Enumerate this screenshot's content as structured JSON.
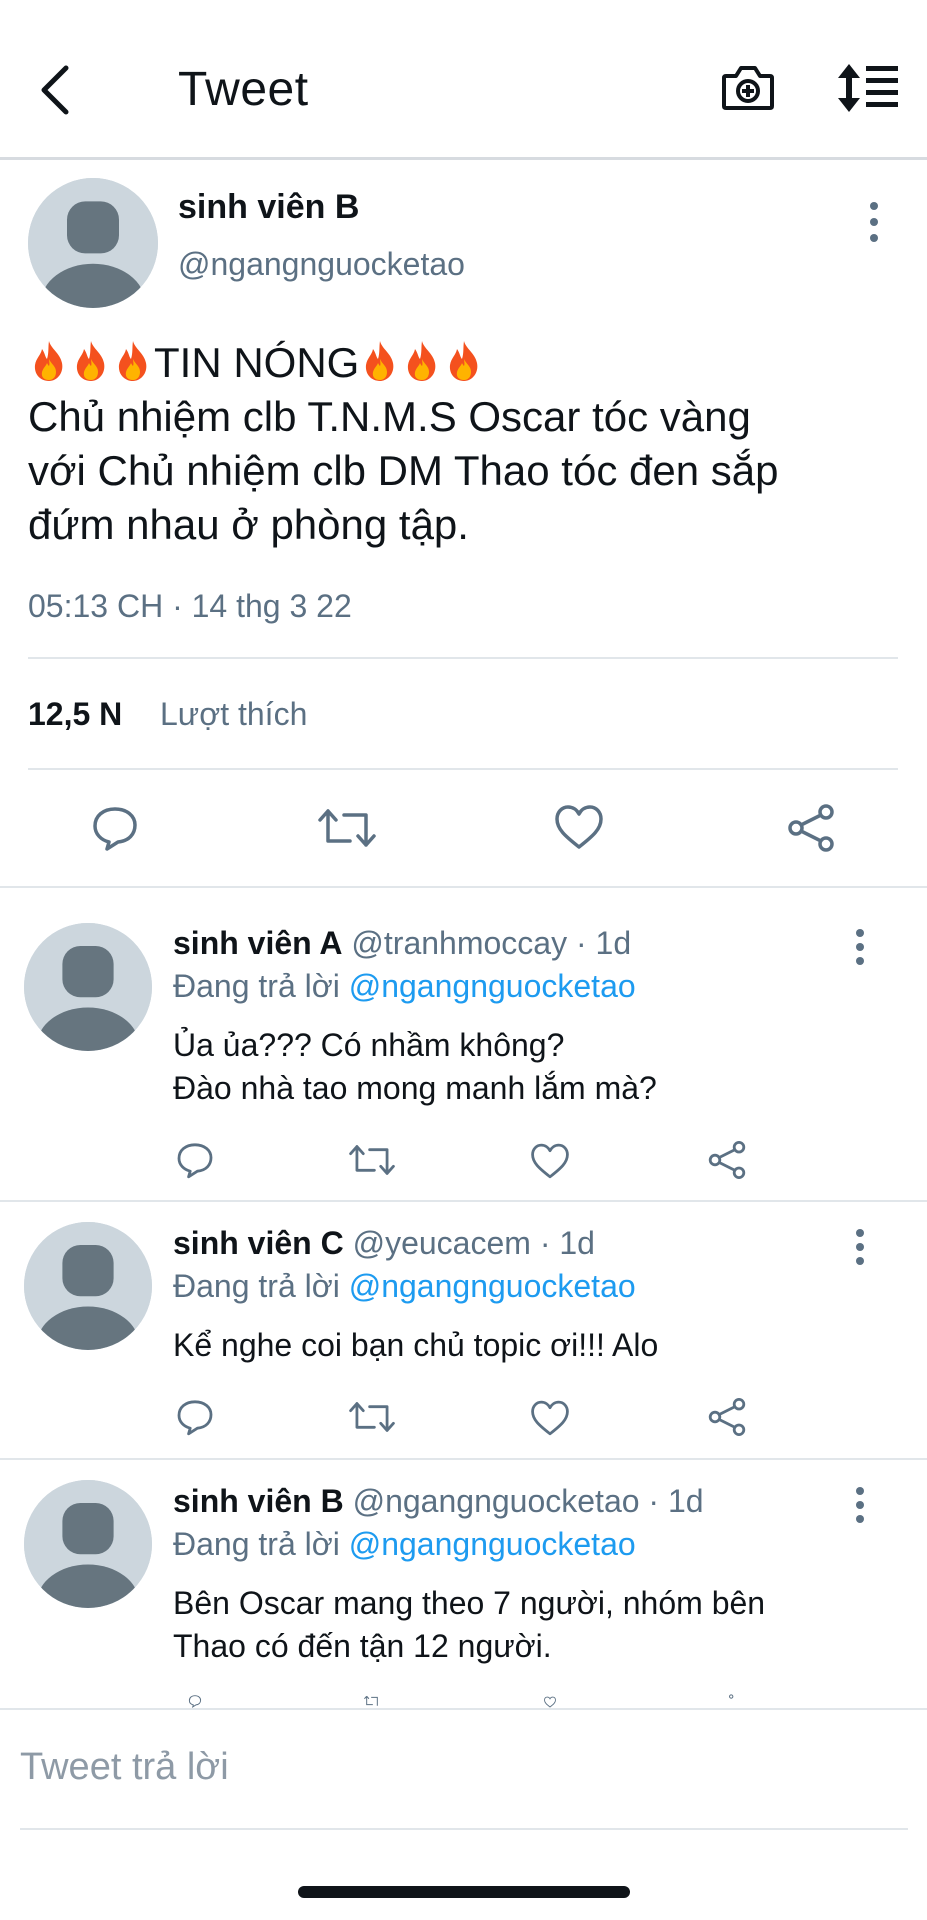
{
  "header": {
    "title": "Tweet",
    "back_icon": "chevron-left-icon",
    "camera_icon": "camera-add-icon",
    "sort_icon": "sort-list-icon"
  },
  "main_tweet": {
    "author_name": "sinh viên B",
    "author_handle": "@ngangnguocketao",
    "headline_text": "TIN NÓNG",
    "body_lines": [
      "Chủ nhiệm clb T.N.M.S Oscar tóc vàng",
      "với Chủ nhiệm clb DM Thao tóc đen sắp",
      "đứm nhau ở phòng tập."
    ],
    "timestamp": "05:13 CH · 14 thg 3 22",
    "likes_count": "12,5 N",
    "likes_label": "Lượt thích",
    "fire_emoji_count_each_side": 3
  },
  "replies": [
    {
      "name": "sinh viên A",
      "meta": "@tranhmoccay · 1d",
      "reply_to_prefix": "Đang trả lời",
      "reply_to_handle": "@ngangnguocketao",
      "text_lines": [
        "Ủa ủa??? Có nhầm không?",
        "Đào nhà tao mong manh lắm mà?"
      ]
    },
    {
      "name": "sinh viên C",
      "meta": "@yeucacem · 1d",
      "reply_to_prefix": "Đang trả lời",
      "reply_to_handle": "@ngangnguocketao",
      "text_lines": [
        "Kể nghe coi bạn chủ topic ơi!!! Alo"
      ]
    },
    {
      "name": "sinh viên B",
      "meta": "@ngangnguocketao · 1d",
      "reply_to_prefix": "Đang trả lời",
      "reply_to_handle": "@ngangnguocketao",
      "text_lines": [
        "Bên Oscar mang theo 7 người, nhóm bên",
        "Thao có đến tận 12 người."
      ]
    }
  ],
  "compose": {
    "placeholder": "Tweet trả lời"
  },
  "colors": {
    "text": "#0f1419",
    "secondary": "#5b7083",
    "link": "#1d9bf0",
    "icon": "#5b7083",
    "divider": "#e1e6ea"
  }
}
